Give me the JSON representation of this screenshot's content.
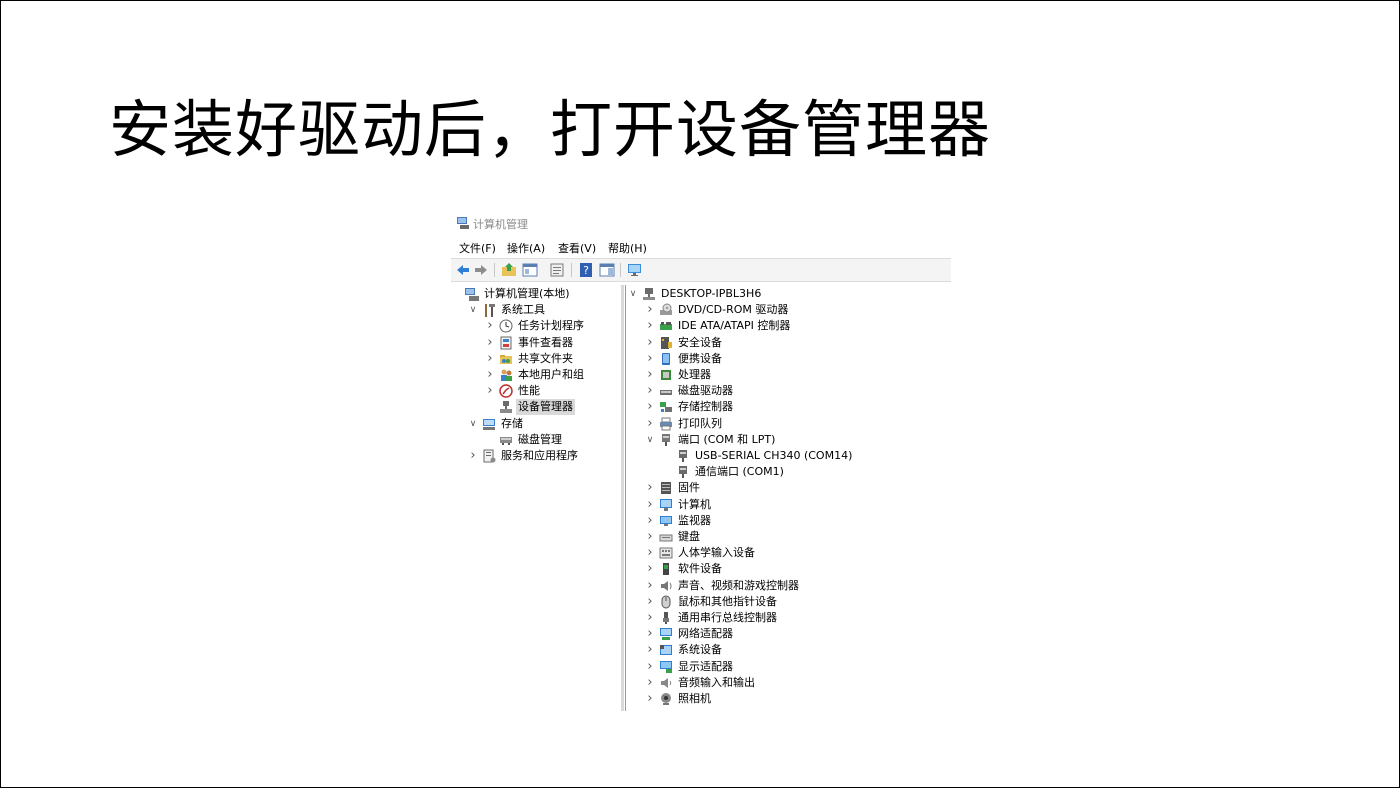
{
  "slide": {
    "title": "安装好驱动后，打开设备管理器"
  },
  "window": {
    "title": "计算机管理",
    "menu": [
      "文件(F)",
      "操作(A)",
      "查看(V)",
      "帮助(H)"
    ]
  },
  "left_tree": [
    {
      "label": "计算机管理(本地)",
      "level": 0,
      "chevron": "",
      "icon": "computer-management-icon"
    },
    {
      "label": "系统工具",
      "level": 1,
      "chevron": "down",
      "icon": "tools-icon"
    },
    {
      "label": "任务计划程序",
      "level": 2,
      "chevron": "right",
      "icon": "clock-icon"
    },
    {
      "label": "事件查看器",
      "level": 2,
      "chevron": "right",
      "icon": "event-viewer-icon"
    },
    {
      "label": "共享文件夹",
      "level": 2,
      "chevron": "right",
      "icon": "shared-folder-icon"
    },
    {
      "label": "本地用户和组",
      "level": 2,
      "chevron": "right",
      "icon": "users-icon"
    },
    {
      "label": "性能",
      "level": 2,
      "chevron": "right",
      "icon": "performance-icon"
    },
    {
      "label": "设备管理器",
      "level": 2,
      "chevron": "",
      "icon": "device-manager-icon",
      "selected": true
    },
    {
      "label": "存储",
      "level": 1,
      "chevron": "down",
      "icon": "storage-icon"
    },
    {
      "label": "磁盘管理",
      "level": 2,
      "chevron": "",
      "icon": "disk-management-icon"
    },
    {
      "label": "服务和应用程序",
      "level": 1,
      "chevron": "right",
      "icon": "services-icon"
    }
  ],
  "right_tree": [
    {
      "label": "DESKTOP-IPBL3H6",
      "level": 0,
      "chevron": "down",
      "icon": "computer-root-icon"
    },
    {
      "label": "DVD/CD-ROM 驱动器",
      "level": 1,
      "chevron": "right",
      "icon": "dvd-icon"
    },
    {
      "label": "IDE ATA/ATAPI 控制器",
      "level": 1,
      "chevron": "right",
      "icon": "ide-controller-icon"
    },
    {
      "label": "安全设备",
      "level": 1,
      "chevron": "right",
      "icon": "security-device-icon"
    },
    {
      "label": "便携设备",
      "level": 1,
      "chevron": "right",
      "icon": "portable-device-icon"
    },
    {
      "label": "处理器",
      "level": 1,
      "chevron": "right",
      "icon": "processor-icon"
    },
    {
      "label": "磁盘驱动器",
      "level": 1,
      "chevron": "right",
      "icon": "disk-drive-icon"
    },
    {
      "label": "存储控制器",
      "level": 1,
      "chevron": "right",
      "icon": "storage-controller-icon"
    },
    {
      "label": "打印队列",
      "level": 1,
      "chevron": "right",
      "icon": "printer-icon"
    },
    {
      "label": "端口 (COM 和 LPT)",
      "level": 1,
      "chevron": "down",
      "icon": "port-icon"
    },
    {
      "label": "USB-SERIAL CH340 (COM14)",
      "level": 2,
      "chevron": "",
      "icon": "port-device-icon"
    },
    {
      "label": "通信端口 (COM1)",
      "level": 2,
      "chevron": "",
      "icon": "port-device-icon"
    },
    {
      "label": "固件",
      "level": 1,
      "chevron": "right",
      "icon": "firmware-icon"
    },
    {
      "label": "计算机",
      "level": 1,
      "chevron": "right",
      "icon": "computer-icon"
    },
    {
      "label": "监视器",
      "level": 1,
      "chevron": "right",
      "icon": "monitor-icon"
    },
    {
      "label": "键盘",
      "level": 1,
      "chevron": "right",
      "icon": "keyboard-icon"
    },
    {
      "label": "人体学输入设备",
      "level": 1,
      "chevron": "right",
      "icon": "hid-icon"
    },
    {
      "label": "软件设备",
      "level": 1,
      "chevron": "right",
      "icon": "software-device-icon"
    },
    {
      "label": "声音、视频和游戏控制器",
      "level": 1,
      "chevron": "right",
      "icon": "sound-icon"
    },
    {
      "label": "鼠标和其他指针设备",
      "level": 1,
      "chevron": "right",
      "icon": "mouse-icon"
    },
    {
      "label": "通用串行总线控制器",
      "level": 1,
      "chevron": "right",
      "icon": "usb-icon"
    },
    {
      "label": "网络适配器",
      "level": 1,
      "chevron": "right",
      "icon": "network-adapter-icon"
    },
    {
      "label": "系统设备",
      "level": 1,
      "chevron": "right",
      "icon": "system-device-icon"
    },
    {
      "label": "显示适配器",
      "level": 1,
      "chevron": "right",
      "icon": "display-adapter-icon"
    },
    {
      "label": "音频输入和输出",
      "level": 1,
      "chevron": "right",
      "icon": "audio-io-icon"
    },
    {
      "label": "照相机",
      "level": 1,
      "chevron": "right",
      "icon": "camera-icon"
    }
  ],
  "toolbar": [
    "back-icon",
    "forward-icon",
    "up-folder-icon",
    "show-tree-icon",
    "properties-icon",
    "help-icon",
    "action-pane-icon",
    "monitor-connect-icon"
  ]
}
